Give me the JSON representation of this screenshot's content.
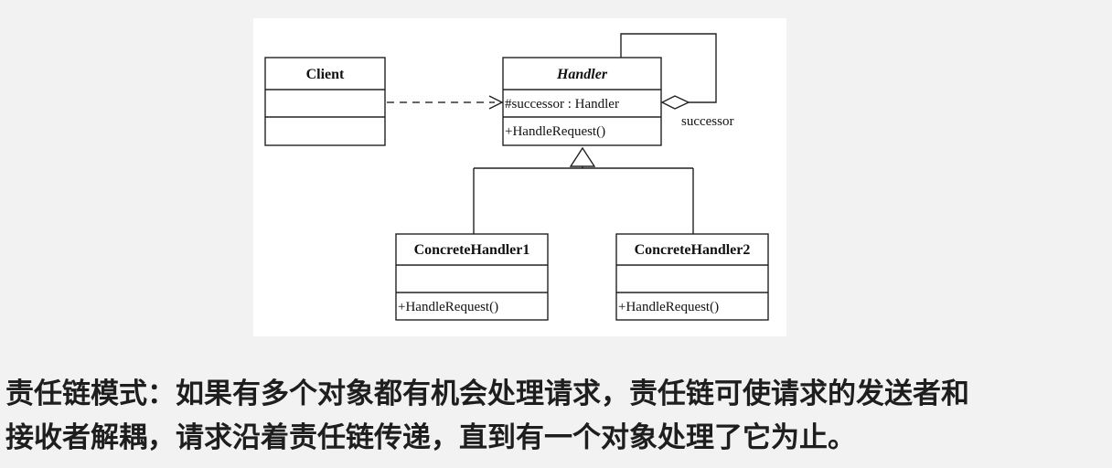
{
  "diagram": {
    "classes": {
      "client": {
        "name": "Client"
      },
      "handler": {
        "name": "Handler",
        "attribute": "#successor : Handler",
        "operation": "+HandleRequest()"
      },
      "concrete1": {
        "name": "ConcreteHandler1",
        "operation": "+HandleRequest()"
      },
      "concrete2": {
        "name": "ConcreteHandler2",
        "operation": "+HandleRequest()"
      }
    },
    "self_association_label": "successor"
  },
  "caption": {
    "line1": "责任链模式：如果有多个对象都有机会处理请求，责任链可使请求的发送者和",
    "line2": "接收者解耦，请求沿着责任链传递，直到有一个对象处理了它为止。"
  }
}
